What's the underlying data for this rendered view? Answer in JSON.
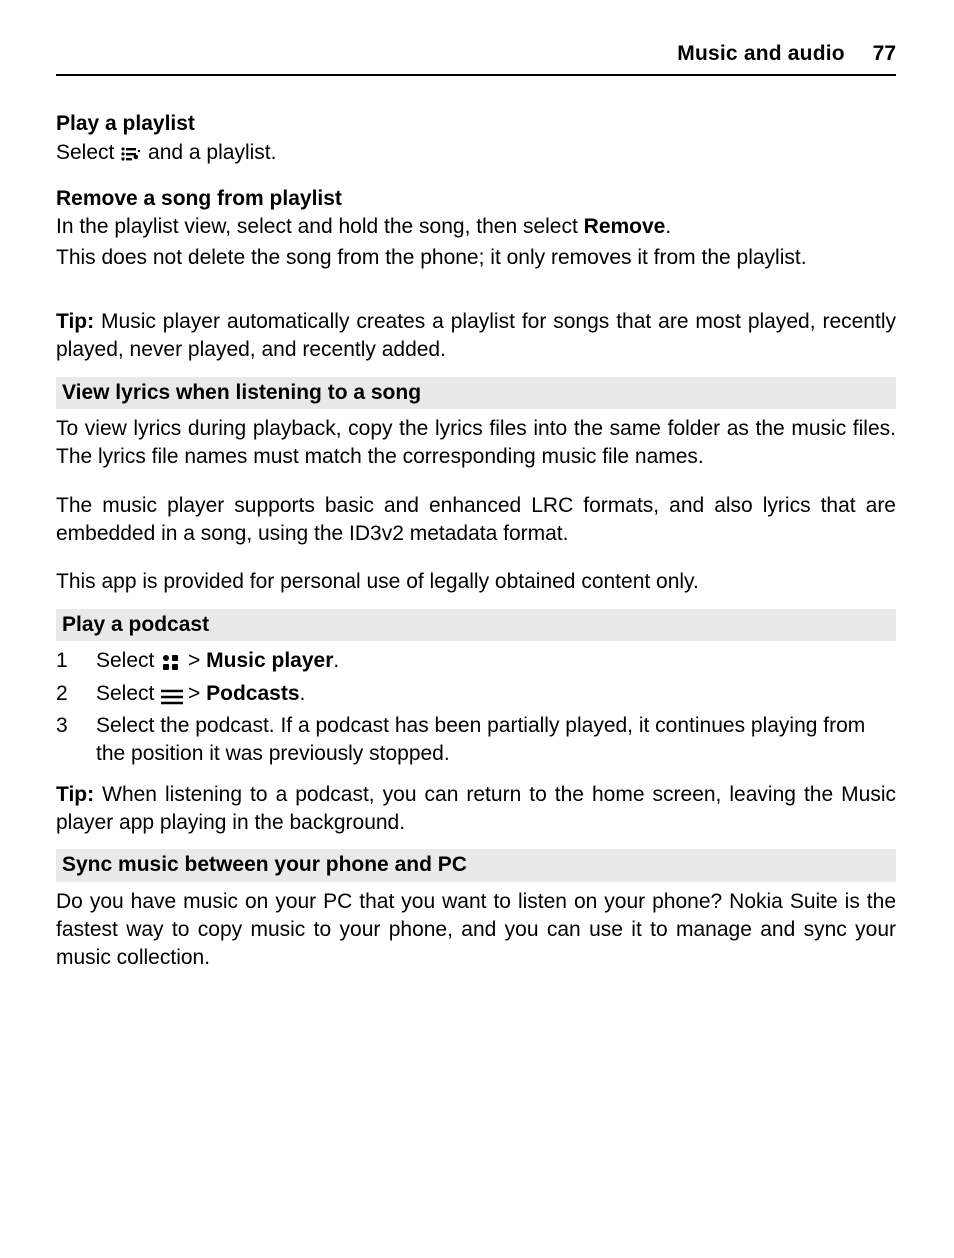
{
  "header": {
    "title": "Music and audio",
    "page": "77"
  },
  "s_play_playlist": {
    "heading": "Play a playlist",
    "line_pre": "Select ",
    "line_post": " and a playlist."
  },
  "s_remove_song": {
    "heading": "Remove a song from playlist",
    "p1_pre": "In the playlist view, select and hold the song, then select ",
    "p1_bold": "Remove",
    "p1_post": ".",
    "p2": "This does not delete the song from the phone; it only removes it from the playlist."
  },
  "tip1": {
    "label": "Tip:",
    "text": " Music player automatically creates a playlist for songs that are most played, recently played, never played, and recently added."
  },
  "s_lyrics": {
    "bar": "View lyrics when listening to a song",
    "p1": "To view lyrics during playback, copy the lyrics files into the same folder as the music files. The lyrics file names must match the corresponding music file names.",
    "p2": "The music player supports basic and enhanced LRC formats, and also lyrics that are embedded in a song, using the ID3v2 metadata format.",
    "p3": "This app is provided for personal use of legally obtained content only."
  },
  "s_podcast": {
    "bar": "Play a podcast",
    "steps": [
      {
        "n": "1",
        "pre": "Select ",
        "mid": " > ",
        "bold": "Music player",
        "post": "."
      },
      {
        "n": "2",
        "pre": "Select ",
        "mid": " > ",
        "bold": "Podcasts",
        "post": "."
      },
      {
        "n": "3",
        "text": "Select the podcast. If a podcast has been partially played, it continues playing from the position it was previously stopped."
      }
    ]
  },
  "tip2": {
    "label": "Tip:",
    "text": " When listening to a podcast, you can return to the home screen, leaving the Music player app playing in the background."
  },
  "s_sync": {
    "bar": "Sync music between your phone and PC",
    "p1": "Do you have music on your PC that you want to listen on your phone? Nokia Suite is the fastest way to copy music to your phone, and you can use it to manage and sync your music collection."
  }
}
